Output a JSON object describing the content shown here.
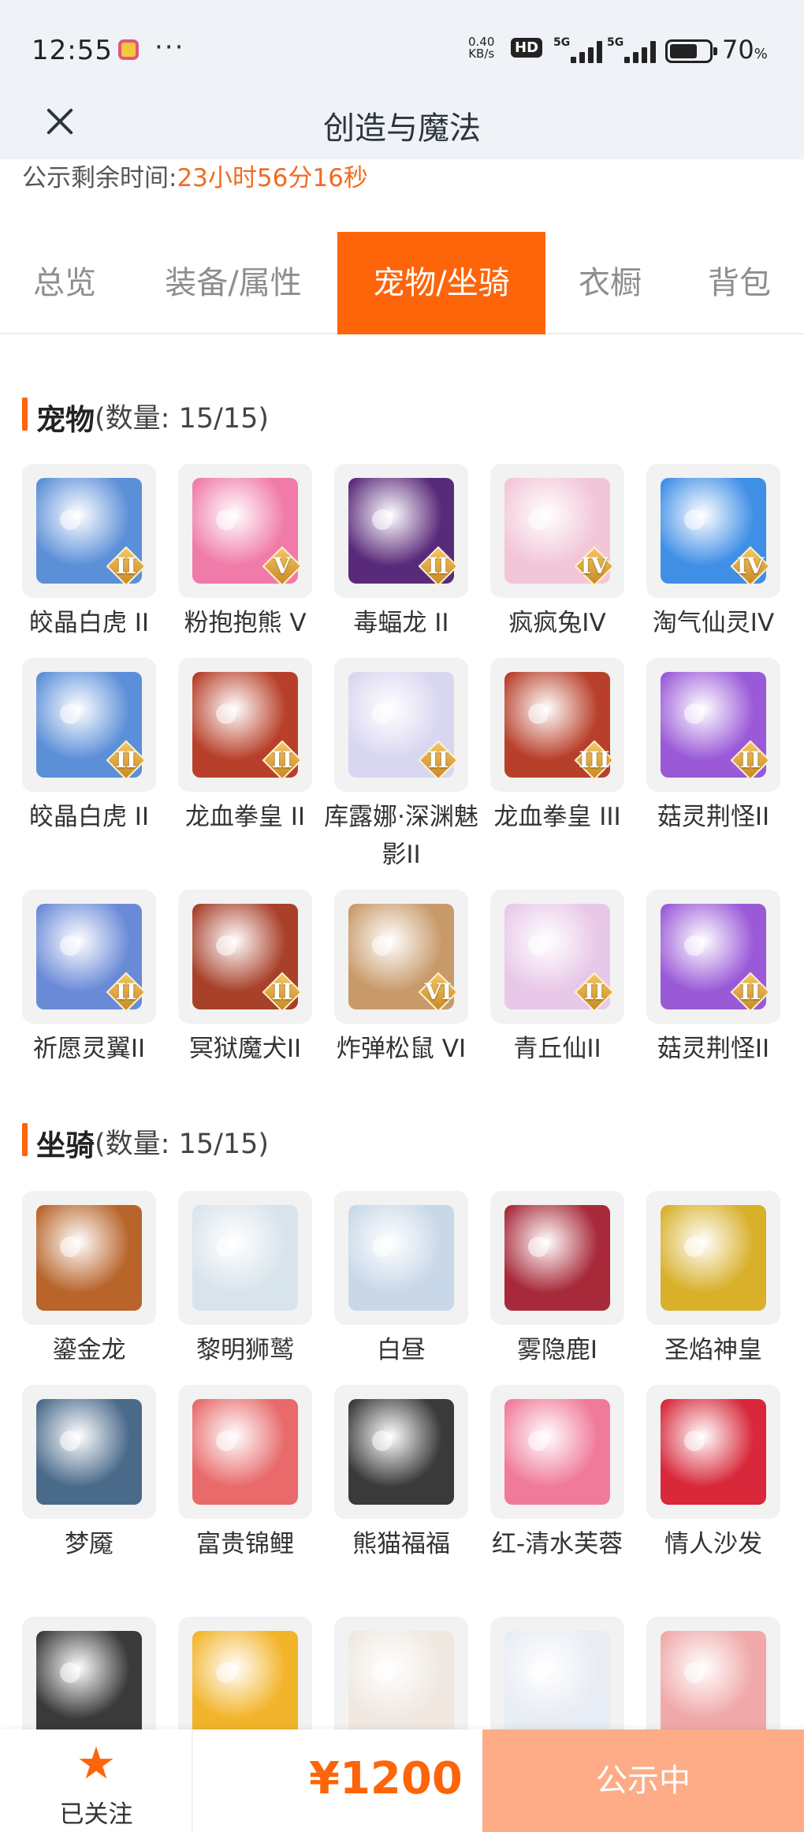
{
  "status_bar": {
    "time": "12:55",
    "speed_value": "0.40",
    "speed_unit": "KB/s",
    "hd": "HD",
    "network_1": "5G",
    "network_2": "5G",
    "battery_value": "70",
    "battery_unit": "%",
    "battery_level": 0.7
  },
  "nav": {
    "title": "创造与魔法",
    "close_icon": "close-icon"
  },
  "notice": {
    "label": "公示剩余时间:",
    "value": "23小时56分16秒"
  },
  "tabs": [
    {
      "label": "总览",
      "active": false
    },
    {
      "label": "装备/属性",
      "active": false
    },
    {
      "label": "宠物/坐骑",
      "active": true
    },
    {
      "label": "衣橱",
      "active": false
    },
    {
      "label": "背包",
      "active": false
    }
  ],
  "pets": {
    "title": "宠物",
    "count": "(数量: 15/15)",
    "items": [
      {
        "name": "皎晶白虎 II",
        "badge": "II",
        "color": "#5b8fd8"
      },
      {
        "name": "粉抱抱熊 V",
        "badge": "V",
        "color": "#f07aa8"
      },
      {
        "name": "毒蝠龙 II",
        "badge": "II",
        "color": "#5a2a7a"
      },
      {
        "name": "疯疯兔IV",
        "badge": "IV",
        "color": "#f2c6d8"
      },
      {
        "name": "淘气仙灵IV",
        "badge": "IV",
        "color": "#3f8fe6"
      },
      {
        "name": "皎晶白虎 II",
        "badge": "II",
        "color": "#5b8fd8"
      },
      {
        "name": "龙血拳皇 II",
        "badge": "II",
        "color": "#b8402a"
      },
      {
        "name": "库露娜·深渊魅影II",
        "badge": "II",
        "color": "#d8d6f0"
      },
      {
        "name": "龙血拳皇 III",
        "badge": "III",
        "color": "#b8402a"
      },
      {
        "name": "菇灵荆怪II",
        "badge": "II",
        "color": "#9a5ad8"
      },
      {
        "name": "祈愿灵翼II",
        "badge": "II",
        "color": "#6a8ad8"
      },
      {
        "name": "冥狱魔犬II",
        "badge": "II",
        "color": "#a8402a"
      },
      {
        "name": "炸弹松鼠 VI",
        "badge": "VI",
        "color": "#c89a6a"
      },
      {
        "name": "青丘仙II",
        "badge": "II",
        "color": "#e8c8e8"
      },
      {
        "name": "菇灵荆怪II",
        "badge": "II",
        "color": "#9a5ad8"
      }
    ]
  },
  "mounts": {
    "title": "坐骑",
    "count": "(数量: 15/15)",
    "items": [
      {
        "name": "鎏金龙",
        "color": "#b8642a"
      },
      {
        "name": "黎明狮鹫",
        "color": "#d8e4ec"
      },
      {
        "name": "白昼",
        "color": "#c8d8e8"
      },
      {
        "name": "雾隐鹿I",
        "color": "#a82a3a"
      },
      {
        "name": "圣焰神皇",
        "color": "#d8b02a"
      },
      {
        "name": "梦魇",
        "color": "#4a6a8a"
      },
      {
        "name": "富贵锦鲤",
        "color": "#e86a6a"
      },
      {
        "name": "熊猫福福",
        "color": "#3a3a3a"
      },
      {
        "name": "红-清水芙蓉",
        "color": "#f07a9a"
      },
      {
        "name": "情人沙发",
        "color": "#d8283a"
      },
      {
        "name": "",
        "color": "#3a3a3a"
      },
      {
        "name": "",
        "color": "#f2b42a"
      },
      {
        "name": "",
        "color": "#f0e8e0"
      },
      {
        "name": "",
        "color": "#e8ecf4"
      },
      {
        "name": "",
        "color": "#f0a8a8"
      }
    ]
  },
  "bottom": {
    "follow_label": "已关注",
    "price": "¥1200",
    "status_button": "公示中"
  }
}
